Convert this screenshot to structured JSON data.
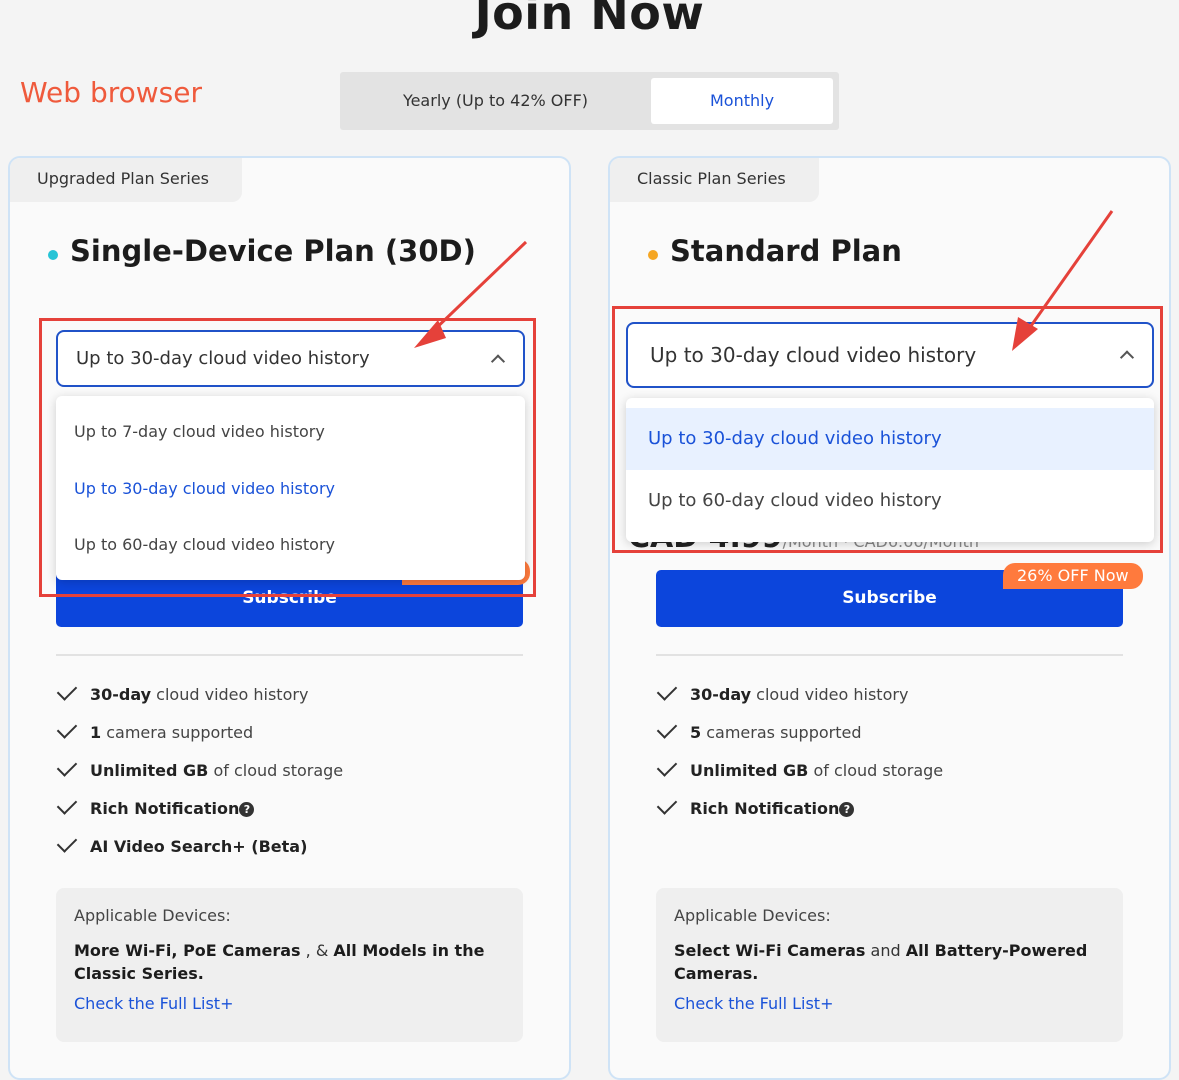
{
  "header": {
    "title": "Join Now",
    "platform_label": "Web browser"
  },
  "billing_toggle": {
    "yearly_label": "Yearly (Up to 42% OFF)",
    "monthly_label": "Monthly",
    "selected": "Monthly"
  },
  "cards": [
    {
      "series": "Upgraded Plan Series",
      "plan_name": "Single-Device Plan (30D)",
      "dot_color": "#26c4d6",
      "selected_option": "Up to 30-day cloud video history",
      "options": [
        "Up to 7-day cloud video history",
        "Up to 30-day cloud video history",
        "Up to 60-day cloud video history"
      ],
      "subscribe_label": "Subscribe",
      "features": {
        "f1_bold": "30-day",
        "f1_rest": " cloud video history",
        "f2_bold": "1",
        "f2_rest": " camera supported",
        "f3_bold": "Unlimited GB",
        "f3_rest": " of cloud storage",
        "f4_bold": "Rich Notification",
        "f5_bold": "AI Video Search+ (Beta)"
      },
      "devices": {
        "title": "Applicable Devices:",
        "text_bold1": "More Wi-Fi, PoE Cameras",
        "text_plain1": " , & ",
        "text_bold2": "All Models in the Classic Series.",
        "link": "Check the Full List+"
      }
    },
    {
      "series": "Classic Plan Series",
      "plan_name": "Standard Plan",
      "dot_color": "#f5a623",
      "selected_option": "Up to 30-day cloud video history",
      "options": [
        "Up to 30-day cloud video history",
        "Up to 60-day cloud video history"
      ],
      "price_main": "CAD 4.99",
      "price_sub": "/Month · CAD6.66/Month",
      "discount_badge": "26% OFF Now",
      "subscribe_label": "Subscribe",
      "features": {
        "f1_bold": "30-day",
        "f1_rest": " cloud video history",
        "f2_bold": "5",
        "f2_rest": " cameras supported",
        "f3_bold": "Unlimited GB",
        "f3_rest": " of cloud storage",
        "f4_bold": "Rich Notification"
      },
      "devices": {
        "title": "Applicable Devices:",
        "text_bold1": "Select Wi-Fi Cameras",
        "text_plain1": " and ",
        "text_bold2": "All Battery-Powered Cameras.",
        "link": "Check the Full List+"
      }
    }
  ],
  "colors": {
    "accent_blue": "#0c45dc",
    "link_blue": "#1a52d8",
    "annotation_red": "#e5413a",
    "badge_orange": "#ff7a3d",
    "card_border": "#cfe3f6"
  }
}
